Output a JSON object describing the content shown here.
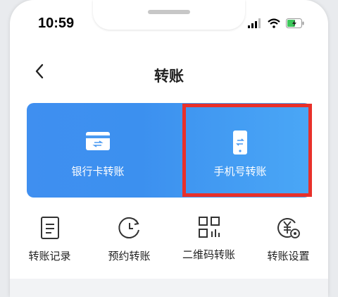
{
  "status_bar": {
    "time": "10:59"
  },
  "header": {
    "title": "转账"
  },
  "transfer_cards": [
    {
      "label": "银行卡转账",
      "icon": "bank-card-transfer-icon"
    },
    {
      "label": "手机号转账",
      "icon": "phone-transfer-icon"
    }
  ],
  "shortcuts": [
    {
      "label": "转账记录",
      "icon": "record-list-icon"
    },
    {
      "label": "预约转账",
      "icon": "clock-icon"
    },
    {
      "label": "二维码转账",
      "icon": "qr-code-icon"
    },
    {
      "label": "转账设置",
      "icon": "settings-yuan-icon"
    }
  ],
  "colors": {
    "card_gradient_start": "#3f8ff0",
    "card_gradient_end": "#4aa7f6",
    "highlight": "#e8302a"
  }
}
